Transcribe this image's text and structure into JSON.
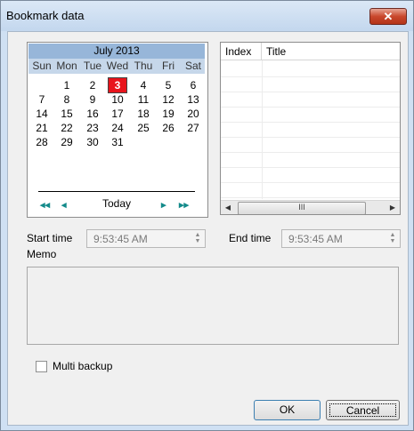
{
  "window": {
    "title": "Bookmark data",
    "close_glyph": "✕"
  },
  "calendar": {
    "month_label": "July 2013",
    "weekdays": [
      "Sun",
      "Mon",
      "Tue",
      "Wed",
      "Thu",
      "Fri",
      "Sat"
    ],
    "weeks": [
      [
        "",
        "1",
        "2",
        "3",
        "4",
        "5",
        "6"
      ],
      [
        "7",
        "8",
        "9",
        "10",
        "11",
        "12",
        "13"
      ],
      [
        "14",
        "15",
        "16",
        "17",
        "18",
        "19",
        "20"
      ],
      [
        "21",
        "22",
        "23",
        "24",
        "25",
        "26",
        "27"
      ],
      [
        "28",
        "29",
        "30",
        "31",
        "",
        "",
        ""
      ]
    ],
    "selected_day": "3",
    "prev_year_glyph": "◂◂",
    "prev_month_glyph": "◂",
    "today_label": "Today",
    "next_month_glyph": "▸",
    "next_year_glyph": "▸▸"
  },
  "list": {
    "columns": [
      "Index",
      "Title"
    ],
    "scroll_left": "◀",
    "scroll_right": "▶",
    "scroll_thumb": "III"
  },
  "start_time": {
    "label": "Start time",
    "value": "9:53:45 AM"
  },
  "end_time": {
    "label": "End time",
    "value": "9:53:45 AM"
  },
  "memo": {
    "label": "Memo",
    "value": ""
  },
  "multi_backup": {
    "label": "Multi backup",
    "checked": false
  },
  "buttons": {
    "ok": "OK",
    "cancel": "Cancel"
  },
  "colors": {
    "title_bar": "#c3d7ee",
    "calendar_header": "#97b6d9",
    "selected_day": "#e8141c",
    "close_button": "#c9472c"
  }
}
